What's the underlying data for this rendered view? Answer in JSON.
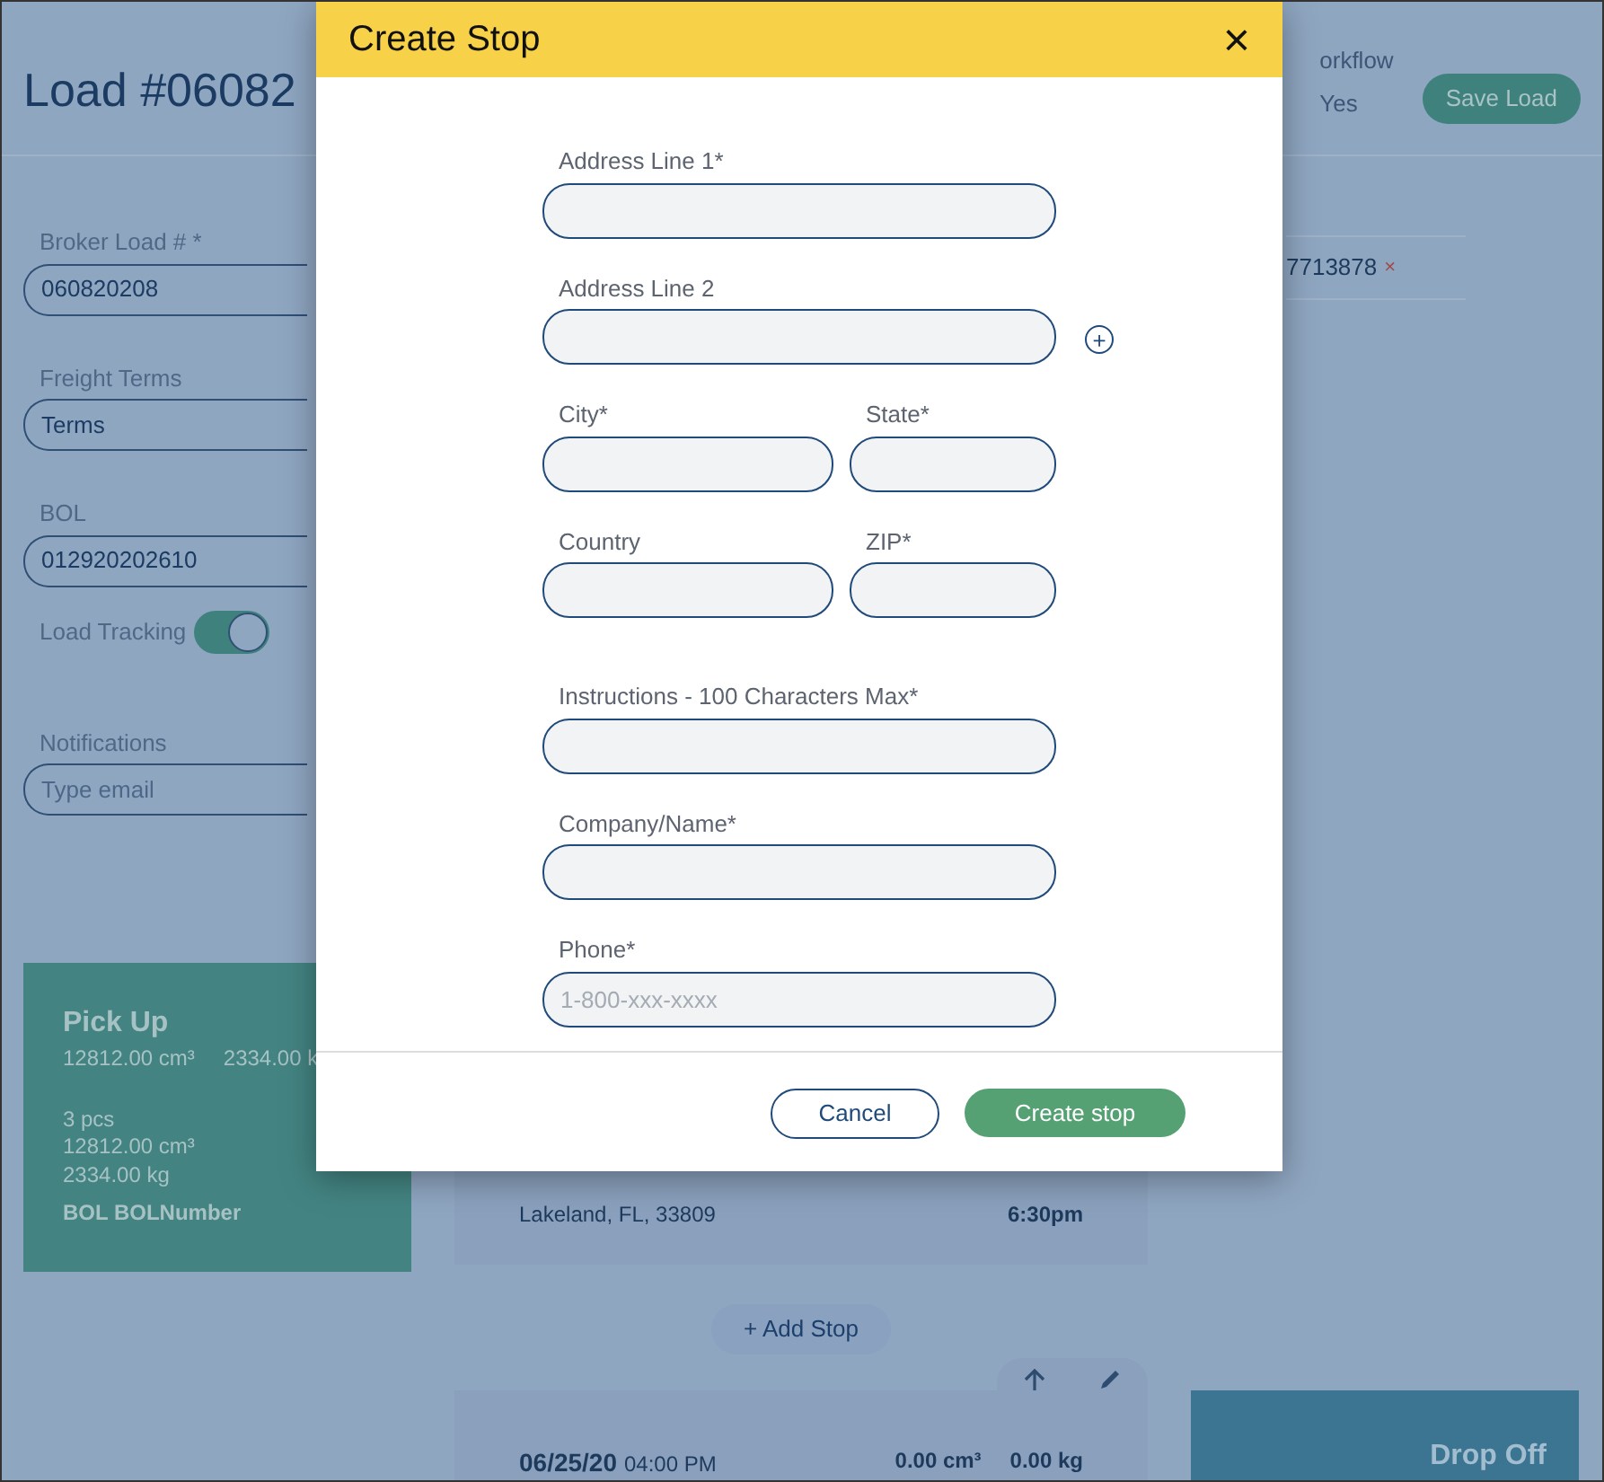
{
  "page": {
    "title": "Load #06082",
    "workflow_label": "orkflow",
    "workflow_value": "Yes",
    "save_button": "Save Load",
    "form": [
      {
        "kind": "field",
        "label": "Broker Load # *",
        "value": "060820208"
      },
      {
        "kind": "field",
        "label": "Freight Terms",
        "value": "Terms"
      },
      {
        "kind": "field",
        "label": "BOL",
        "value": "012920202610"
      },
      {
        "kind": "toggle",
        "label": "Load Tracking",
        "on": true
      },
      {
        "kind": "field",
        "label": "Notifications",
        "placeholder": "Type email"
      }
    ],
    "tag": {
      "text": "7713878",
      "remove": "×"
    },
    "pickup": {
      "title": "Pick Up",
      "volume": "12812.00 cm³",
      "weight": "2334.00 k",
      "lines": [
        "3 pcs",
        "12812.00 cm³",
        "2334.00 kg"
      ],
      "bol": "BOL BOLNumber"
    },
    "stop": {
      "address": "Lakeland, FL, 33809",
      "close": "6:30pm"
    },
    "add_stop": "+ Add Stop",
    "dropoff_stop": {
      "date": "06/25/20",
      "time": "04:00 PM",
      "volume": "0.00 cm³",
      "weight": "0.00 kg"
    },
    "dropoff": {
      "title": "Drop Off"
    }
  },
  "modal": {
    "title": "Create Stop",
    "close": "×",
    "sections": [
      [
        [
          {
            "label": "Address Line 1*"
          }
        ],
        [
          {
            "label": "Address Line 2",
            "add": "+"
          }
        ],
        [
          {
            "label": "City*"
          },
          {
            "label": "State*"
          }
        ],
        [
          {
            "label": "Country"
          },
          {
            "label": "ZIP*"
          }
        ]
      ],
      [
        [
          {
            "label": "Instructions - 100 Characters Max*"
          }
        ],
        [
          {
            "label": "Company/Name*"
          }
        ],
        [
          {
            "label": "Phone*",
            "placeholder": "1-800-xxx-xxxx"
          }
        ]
      ]
    ],
    "buttons": [
      {
        "kind": "secondary",
        "label": "Cancel"
      },
      {
        "kind": "primary",
        "label": "Create stop"
      }
    ]
  }
}
